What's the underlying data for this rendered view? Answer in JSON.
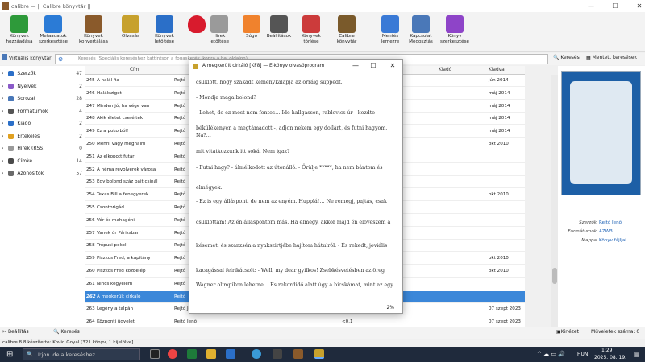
{
  "window": {
    "title": "calibre — || Calibre könyvtár ||",
    "minimize": "—",
    "maximize": "☐",
    "close": "✕"
  },
  "toolbar": [
    {
      "label": "Könyvek\nhozzáadása",
      "icon": "add-books-icon",
      "color": "#2e9a3a"
    },
    {
      "label": "Metaadatok\nszerkesztése",
      "icon": "edit-metadata-icon",
      "color": "#2b7bd6"
    },
    {
      "label": "Könyvek\nkonvertálása",
      "icon": "convert-books-icon",
      "color": "#8a5a2b"
    },
    {
      "label": "Olvasás",
      "icon": "read-icon",
      "color": "#c7a12d"
    },
    {
      "label": "Könyvek\nletöltése",
      "icon": "download-books-icon",
      "color": "#2b6fc8"
    },
    {
      "label": "",
      "icon": "heart-icon",
      "color": "#d81b2d"
    },
    {
      "label": "Hírek\nletöltése",
      "icon": "fetch-news-icon",
      "color": "#9a9a9a"
    },
    {
      "label": "Súgó",
      "icon": "help-icon",
      "color": "#f0822d"
    },
    {
      "label": "Beállítások",
      "icon": "preferences-icon",
      "color": "#555555"
    },
    {
      "label": "Könyvek\ntörlése",
      "icon": "remove-books-icon",
      "color": "#cc3b3b"
    },
    {
      "label": "Calibre könyvtár",
      "icon": "library-icon",
      "color": "#7a5a2b"
    },
    {
      "label": "Mentés\nlemezre",
      "icon": "save-to-disk-icon",
      "color": "#3a7ad6"
    },
    {
      "label": "Kapcsolat\nMegosztás",
      "icon": "connect-share-icon",
      "color": "#4a78b8"
    },
    {
      "label": "Könyv\nszerkesztése",
      "icon": "edit-book-icon",
      "color": "#8e44c8"
    }
  ],
  "search": {
    "virtual_library": "Virtuális könyvtár",
    "placeholder": "Keresés (Speciális kereséshez kattintson a fogaskerék ikonra a bal oldalon)",
    "search_button": "Keresés",
    "saved_search_button": "Mentett keresések"
  },
  "sidebar": [
    {
      "label": "Szerzők",
      "count": "47",
      "color": "#2b6fc8"
    },
    {
      "label": "Nyelvek",
      "count": "2",
      "color": "#8a5ac8"
    },
    {
      "label": "Sorozat",
      "count": "28",
      "color": "#4a78b8"
    },
    {
      "label": "Formátumok",
      "count": "4",
      "color": "#555555"
    },
    {
      "label": "Kiadó",
      "count": "2",
      "color": "#2b6fc8"
    },
    {
      "label": "Értékelés",
      "count": "2",
      "color": "#e0a020"
    },
    {
      "label": "Hírek (RSS)",
      "count": "0",
      "color": "#9a9a9a"
    },
    {
      "label": "Címke",
      "count": "14",
      "color": "#4a4a4a"
    },
    {
      "label": "Azonosítók",
      "count": "57",
      "color": "#6a6a6a"
    }
  ],
  "grid": {
    "headers": {
      "title": "Cím",
      "publisher": "Kiadó",
      "date": "Kiadva"
    },
    "rows": [
      {
        "n": "245",
        "title": "A halál fia",
        "author": "Rejtő",
        "date": "jún 2014"
      },
      {
        "n": "246",
        "title": "Halálsziget",
        "author": "Rejtő",
        "date": "máj 2014"
      },
      {
        "n": "247",
        "title": "Minden jó, ha vége van",
        "author": "Rejtő",
        "date": "máj 2014"
      },
      {
        "n": "248",
        "title": "Akik életet cseréltek",
        "author": "Rejtő",
        "date": "máj 2014"
      },
      {
        "n": "249",
        "title": "Ez a pokolból!",
        "author": "Rejtő",
        "date": "máj 2014"
      },
      {
        "n": "250",
        "title": "Menni vagy meghalni",
        "author": "Rejtő",
        "date": "okt 2010"
      },
      {
        "n": "251",
        "title": "Az elkopott futár",
        "author": "Rejtő",
        "date": ""
      },
      {
        "n": "252",
        "title": "A néma revolverek városa",
        "author": "Rejtő",
        "date": ""
      },
      {
        "n": "253",
        "title": "Egy bolond száz bajt csinál",
        "author": "Rejtő",
        "date": ""
      },
      {
        "n": "254",
        "title": "Texas Bill a fenegyerek",
        "author": "Rejtő",
        "date": "okt 2010"
      },
      {
        "n": "255",
        "title": "Csontbrigád",
        "author": "Rejtő",
        "date": ""
      },
      {
        "n": "256",
        "title": "Vér és mahagóni",
        "author": "Rejtő",
        "date": ""
      },
      {
        "n": "257",
        "title": "Vanek úr Párizsban",
        "author": "Rejtő",
        "date": ""
      },
      {
        "n": "258",
        "title": "Trópusi pokol",
        "author": "Rejtő",
        "date": ""
      },
      {
        "n": "259",
        "title": "Piszkos Fred, a kapitány",
        "author": "Rejtő",
        "date": "okt 2010"
      },
      {
        "n": "260",
        "title": "Piszkos Fred közbelép",
        "author": "Rejtő",
        "date": "okt 2010"
      },
      {
        "n": "261",
        "title": "Nincs kegyelem",
        "author": "Rejtő",
        "date": ""
      },
      {
        "n": "262",
        "title": "A megkerült cirkáló",
        "author": "Rejtő",
        "date": "",
        "selected": true
      },
      {
        "n": "263",
        "title": "Legény a talpán",
        "author": "Rejtő Jenő",
        "date": "07 szept 2023",
        "size": "0.7"
      },
      {
        "n": "264",
        "title": "Központi ügyelet",
        "author": "Rejtő Jenő",
        "date": "07 szept 2023",
        "size": "<0.1"
      }
    ]
  },
  "details": [
    {
      "key": "Szerzők",
      "value": "Rejtő Jenő"
    },
    {
      "key": "Formátumok",
      "value": "AZW3"
    },
    {
      "key": "Mappa",
      "value": "Könyv fájljai"
    }
  ],
  "viewer": {
    "title": "A megkerült cirkáló [KF8] — E-könyv olvasóprogram",
    "paragraphs": [
      "csuklott, hogy szakadt keménykalapja az orráig süppedt.",
      "- Mondja maga bolond?",
      "- Lehet, de ez most nem fontos… Ide hallgasson, rablovics úr - kezdte",
      "békülékenyen a megtámadott -, adjon nekem egy dollárt, és futni hagyom. Na?…",
      "mit vitatkozzunk itt soká. Nem igaz?",
      "- Futni hagy? - álmélkodott az útonálló. - Őrülje *****, ha nem bántom és",
      "elmégyek.",
      "- Ez is egy álláspont, de nem az enyém. Hupplá!… Ne remegj, pajtás, csak",
      "csuklottam! Az én álláspontom más. Ha elmegy, akkor majd én elöveszem a",
      "késemet, és szanzsén a nyakszirtjébe hajítom hátulról. - És rekedt, joviális",
      "kacagással felrikácsolt: - Well, my dear gyilkos! Zsebkésvetésben az öreg",
      "Wagner olimpikon lehetne… És rekordidő alatt úgy a bicskámat, mint az egy"
    ],
    "progress": "2%"
  },
  "bottom": {
    "prefs": "Beállítás",
    "search": "Keresés",
    "cover_toggle": "Kinézet",
    "jobs": "Műveletek száma: 0"
  },
  "status": {
    "text": "calibre 8.8 készítette: Kovid Goyal   [321 könyv, 1 kijelölve]"
  },
  "taskbar": {
    "search_placeholder": "Írjon ide a kereséshez",
    "lang": "HUN",
    "time": "1:29",
    "date": "2025. 08. 19."
  }
}
